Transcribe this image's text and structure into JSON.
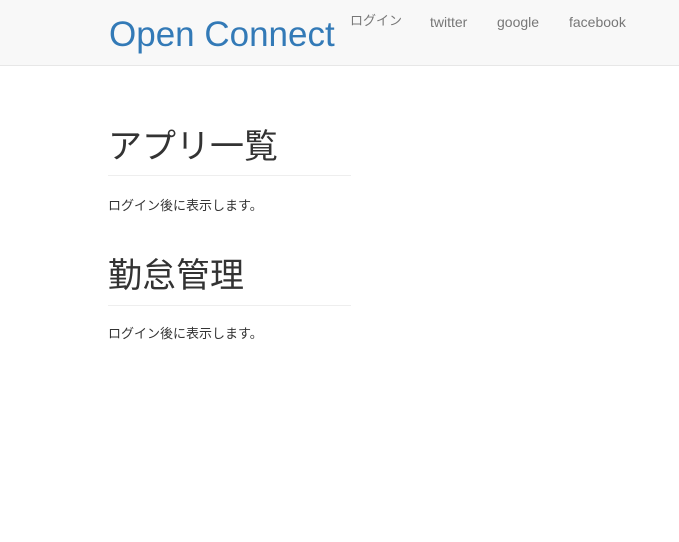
{
  "navbar": {
    "brand": "Open Connect",
    "links": [
      {
        "label": "ログイン"
      },
      {
        "label": "twitter"
      },
      {
        "label": "google"
      },
      {
        "label": "facebook"
      }
    ]
  },
  "sections": [
    {
      "title": "アプリ一覧",
      "body": "ログイン後に表示します。"
    },
    {
      "title": "勤怠管理",
      "body": "ログイン後に表示します。"
    }
  ],
  "colors": {
    "brand": "#337ab7",
    "navbar_bg": "#f8f8f8",
    "nav_link": "#777777",
    "text": "#333333"
  }
}
